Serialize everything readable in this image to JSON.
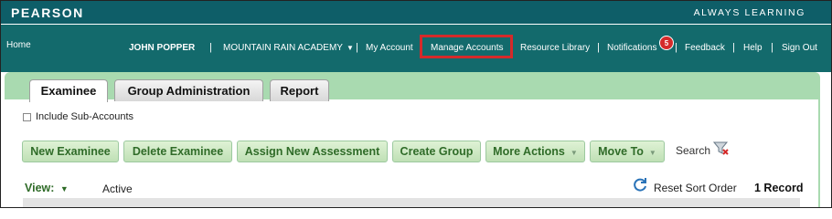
{
  "brand": {
    "logo": "PEARSON",
    "tagline": "ALWAYS LEARNING"
  },
  "nav": {
    "home": "Home",
    "user": "JOHN POPPER",
    "academy": "MOUNTAIN RAIN ACADEMY",
    "my_account": "My Account",
    "manage_accounts": "Manage Accounts",
    "resource_library": "Resource Library",
    "notifications": "Notifications",
    "notification_count": "5",
    "feedback": "Feedback",
    "help": "Help",
    "sign_out": "Sign Out",
    "separator": "|"
  },
  "tabs": [
    "Examinee",
    "Group Administration",
    "Report"
  ],
  "include_sub_accounts": "Include Sub-Accounts",
  "actions": {
    "new_examinee": "New Examinee",
    "delete_examinee": "Delete Examinee",
    "assign_new_assessment": "Assign New Assessment",
    "create_group": "Create Group",
    "more_actions": "More Actions",
    "move_to": "Move To"
  },
  "search": "Search",
  "view": {
    "label": "View:",
    "value": "Active"
  },
  "reset_sort_order": "Reset Sort Order",
  "record_count": "1 Record",
  "colors": {
    "brand_bar": "#0e5e68",
    "nav_bar": "#136a6c",
    "highlight": "#d42a2a",
    "panel": "#a9dab0",
    "button_text": "#2f6b28"
  }
}
